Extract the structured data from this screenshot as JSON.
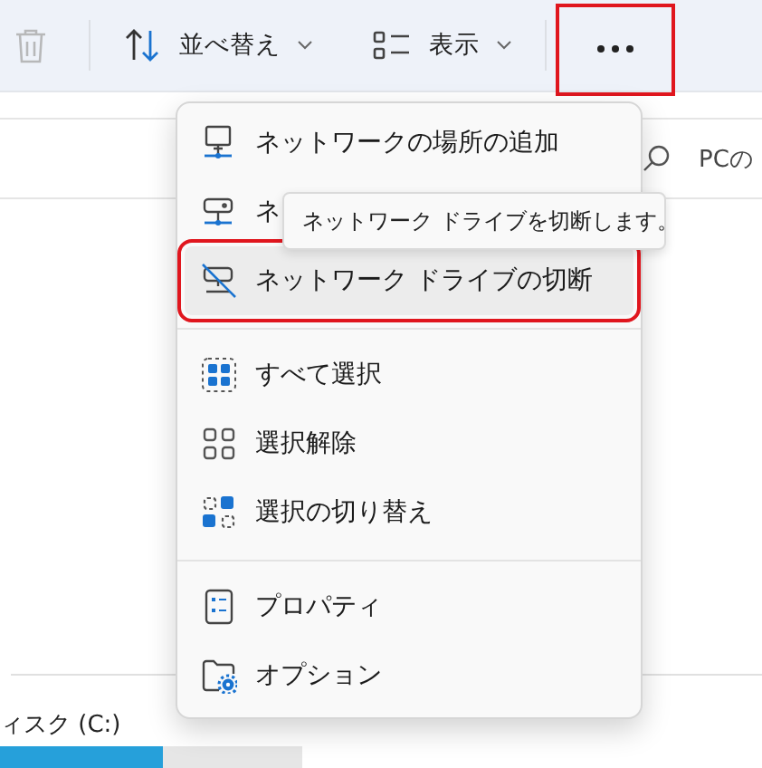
{
  "toolbar": {
    "items": [
      {
        "kind": "delete",
        "disabled": true
      },
      {
        "kind": "sort",
        "label": "並べ替え"
      },
      {
        "kind": "view",
        "label": "表示"
      },
      {
        "kind": "more",
        "highlighted": true
      }
    ]
  },
  "search": {
    "placeholder": "PCの"
  },
  "drive": {
    "label": "ィスク (C:)",
    "level": 0.54
  },
  "menu": {
    "items": [
      {
        "kind": "add-network",
        "label": "ネットワークの場所の追加",
        "hovered": false,
        "highlighted": false
      },
      {
        "kind": "map-drive",
        "label": "ネ",
        "hovered": false,
        "highlighted": false
      },
      {
        "kind": "disconnect",
        "label": "ネットワーク ドライブの切断",
        "hovered": true,
        "highlighted": true
      },
      {
        "kind": "separator"
      },
      {
        "kind": "select-all",
        "label": "すべて選択",
        "hovered": false,
        "highlighted": false
      },
      {
        "kind": "select-none",
        "label": "選択解除",
        "hovered": false,
        "highlighted": false
      },
      {
        "kind": "invert",
        "label": "選択の切り替え",
        "hovered": false,
        "highlighted": false
      },
      {
        "kind": "separator"
      },
      {
        "kind": "properties",
        "label": "プロパティ",
        "hovered": false,
        "highlighted": false
      },
      {
        "kind": "options",
        "label": "オプション",
        "hovered": false,
        "highlighted": false
      }
    ]
  },
  "tooltip": {
    "text": "ネットワーク ドライブを切断します。"
  }
}
